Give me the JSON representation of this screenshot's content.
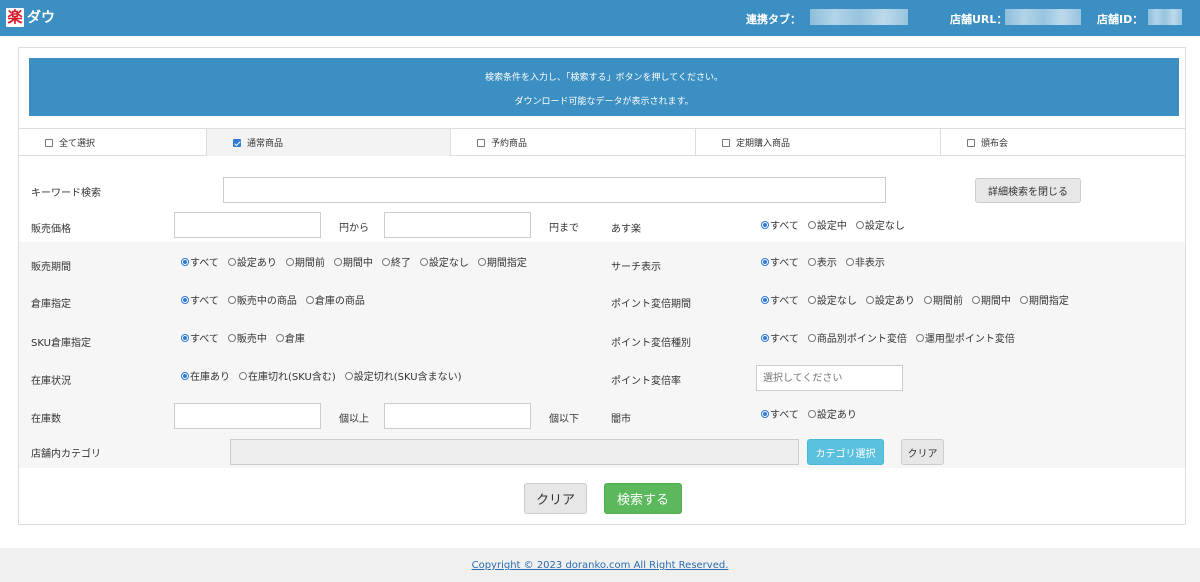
{
  "header": {
    "app_name": "ダウ",
    "logo_glyph": "楽",
    "link_tab_label": "連携タブ：",
    "shop_url_label": "店舗URL：",
    "shop_id_label": "店舗ID："
  },
  "notice": {
    "line1": "検索条件を入力し、「検索する」ボタンを押してください。",
    "line2": "ダウンロード可能なデータが表示されます。"
  },
  "product_types": [
    {
      "label": "全て選択",
      "checked": false
    },
    {
      "label": "通常商品",
      "checked": true
    },
    {
      "label": "予約商品",
      "checked": false
    },
    {
      "label": "定期購入商品",
      "checked": false
    },
    {
      "label": "頒布会",
      "checked": false
    }
  ],
  "form": {
    "keyword_label": "キーワード検索",
    "keyword_value": "",
    "detail_close_button": "詳細検索を閉じる",
    "price_label": "販売価格",
    "price_from_suffix": "円から",
    "price_to_suffix": "円まで",
    "asuraku_label": "あす楽",
    "asuraku_options": [
      "すべて",
      "設定中",
      "設定なし"
    ],
    "sale_period_label": "販売期間",
    "sale_period_options": [
      "すべて",
      "設定あり",
      "期間前",
      "期間中",
      "終了",
      "設定なし",
      "期間指定"
    ],
    "search_display_label": "サーチ表示",
    "search_display_options": [
      "すべて",
      "表示",
      "非表示"
    ],
    "warehouse_label": "倉庫指定",
    "warehouse_options": [
      "すべて",
      "販売中の商品",
      "倉庫の商品"
    ],
    "point_period_label": "ポイント変倍期間",
    "point_period_options": [
      "すべて",
      "設定なし",
      "設定あり",
      "期間前",
      "期間中",
      "期間指定"
    ],
    "sku_warehouse_label": "SKU倉庫指定",
    "sku_warehouse_options": [
      "すべて",
      "販売中",
      "倉庫"
    ],
    "point_type_label": "ポイント変倍種別",
    "point_type_options": [
      "すべて",
      "商品別ポイント変倍",
      "運用型ポイント変倍"
    ],
    "stock_status_label": "在庫状況",
    "stock_status_options": [
      "在庫あり",
      "在庫切れ(SKU含む)",
      "設定切れ(SKU含まない)"
    ],
    "point_rate_label": "ポイント変倍率",
    "point_rate_placeholder": "選択してください",
    "stock_count_label": "在庫数",
    "stock_min_suffix": "個以上",
    "stock_max_suffix": "個以下",
    "black_market_label": "闇市",
    "black_market_options": [
      "すべて",
      "設定あり"
    ],
    "shop_category_label": "店舗内カテゴリ",
    "category_select_button": "カテゴリ選択",
    "category_clear_button": "クリア"
  },
  "actions": {
    "clear_button": "クリア",
    "search_button": "検索する"
  },
  "footer": {
    "copyright": "Copyright © 2023 doranko.com All Right Reserved."
  }
}
